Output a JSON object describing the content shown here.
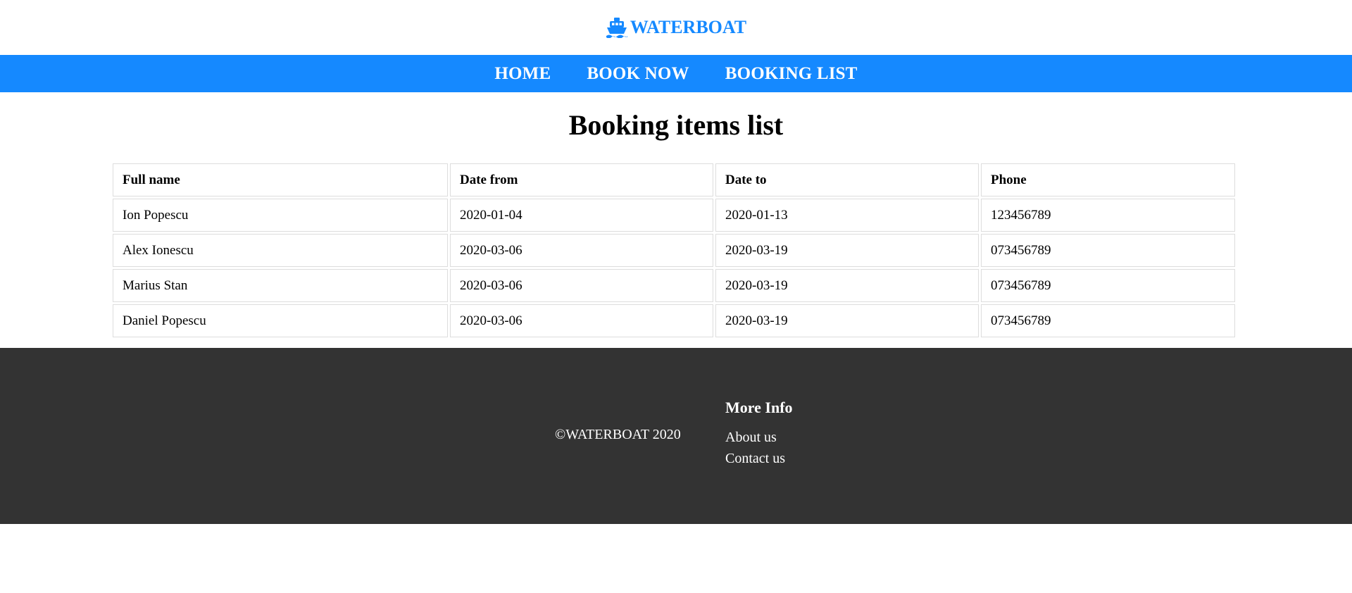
{
  "brand": {
    "name": "WATERBOAT",
    "icon": "ship-icon",
    "color": "#1589ff"
  },
  "nav": {
    "background": "#1589ff",
    "items": [
      {
        "label": "HOME"
      },
      {
        "label": "BOOK NOW"
      },
      {
        "label": "BOOKING LIST"
      }
    ]
  },
  "main": {
    "title": "Booking items list",
    "table": {
      "headers": [
        "Full name",
        "Date from",
        "Date to",
        "Phone"
      ],
      "rows": [
        [
          "Ion Popescu",
          "2020-01-04",
          "2020-01-13",
          "123456789"
        ],
        [
          "Alex Ionescu",
          "2020-03-06",
          "2020-03-19",
          "073456789"
        ],
        [
          "Marius Stan",
          "2020-03-06",
          "2020-03-19",
          "073456789"
        ],
        [
          "Daniel Popescu",
          "2020-03-06",
          "2020-03-19",
          "073456789"
        ]
      ]
    }
  },
  "footer": {
    "background": "#333333",
    "copyright": "©WATERBOAT 2020",
    "more_info": {
      "title": "More Info",
      "links": [
        {
          "label": "About us"
        },
        {
          "label": "Contact us"
        }
      ]
    }
  }
}
